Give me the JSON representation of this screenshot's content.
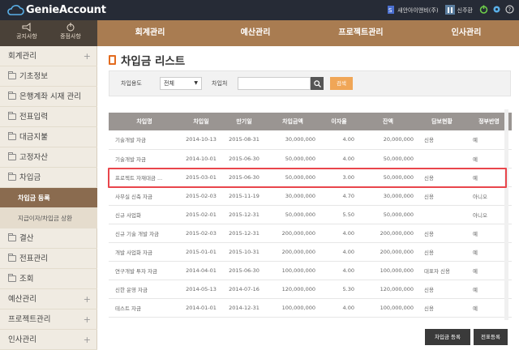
{
  "app": {
    "logo_text": "GenieAccount"
  },
  "topright": {
    "company": "새안아이앤비(주)",
    "user": "신주환"
  },
  "lefttop": {
    "notice": "공지사항",
    "important": "중점사항"
  },
  "nav": {
    "items": [
      "회계관리",
      "예산관리",
      "프로젝트관리",
      "인사관리"
    ]
  },
  "sidebar": {
    "items": [
      {
        "label": "회계관리",
        "plus": "+"
      },
      {
        "label": "기초정보"
      },
      {
        "label": "은행계좌 시재 관리"
      },
      {
        "label": "전표입력"
      },
      {
        "label": "대금지불"
      },
      {
        "label": "고정자산"
      },
      {
        "label": "차입금"
      },
      {
        "label": "차입금 등록"
      },
      {
        "label": "지급이자/차입금 상환"
      },
      {
        "label": "결산"
      },
      {
        "label": "전표관리"
      },
      {
        "label": "조회"
      },
      {
        "label": "예산관리",
        "plus": "+"
      },
      {
        "label": "프로젝트관리",
        "plus": "+"
      },
      {
        "label": "인사관리",
        "plus": "+"
      }
    ]
  },
  "page": {
    "title": "차입금 리스트"
  },
  "filter": {
    "usage_label": "차입용도",
    "usage_value": "전체",
    "lender_label": "차입처",
    "lookup_label": "검색"
  },
  "table": {
    "headers": [
      "차입명",
      "차입일",
      "만기일",
      "차입금액",
      "이자율",
      "잔액",
      "담보현황",
      "정부반영"
    ],
    "rows": [
      [
        "기술개발 자금",
        "2014-10-13",
        "2015-08-31",
        "30,000,000",
        "4.00",
        "20,000,000",
        "신용",
        "예"
      ],
      [
        "기술개발 자금",
        "2014-10-01",
        "2015-06-30",
        "50,000,000",
        "4.00",
        "50,000,000",
        "",
        "예"
      ],
      [
        "프로젝트 자재대금 ...",
        "2015-03-01",
        "2015-06-30",
        "50,000,000",
        "3.00",
        "50,000,000",
        "신용",
        "예"
      ],
      [
        "사무실 신축 자금",
        "2015-02-03",
        "2015-11-19",
        "30,000,000",
        "4.70",
        "30,000,000",
        "신용",
        "아니오"
      ],
      [
        "신규 사업화",
        "2015-02-01",
        "2015-12-31",
        "50,000,000",
        "5.50",
        "50,000,000",
        "",
        "아니오"
      ],
      [
        "신규 기술 개발 자금",
        "2015-02-03",
        "2015-12-31",
        "200,000,000",
        "4.00",
        "200,000,000",
        "신용",
        "예"
      ],
      [
        "개발 사업화 자금",
        "2015-01-01",
        "2015-10-31",
        "200,000,000",
        "4.00",
        "200,000,000",
        "신용",
        "예"
      ],
      [
        "연구개발 투자 자금",
        "2014-04-01",
        "2015-06-30",
        "100,000,000",
        "4.00",
        "100,000,000",
        "대표자 신용",
        "예"
      ],
      [
        "신한 운영 자금",
        "2014-05-13",
        "2014-07-16",
        "120,000,000",
        "5.30",
        "120,000,000",
        "신용",
        "예"
      ],
      [
        "테스트 자금",
        "2014-01-01",
        "2014-12-31",
        "100,000,000",
        "4.00",
        "100,000,000",
        "신용",
        "예"
      ]
    ]
  },
  "buttons": {
    "register": "차입금 등록",
    "voucher": "전표등록"
  }
}
